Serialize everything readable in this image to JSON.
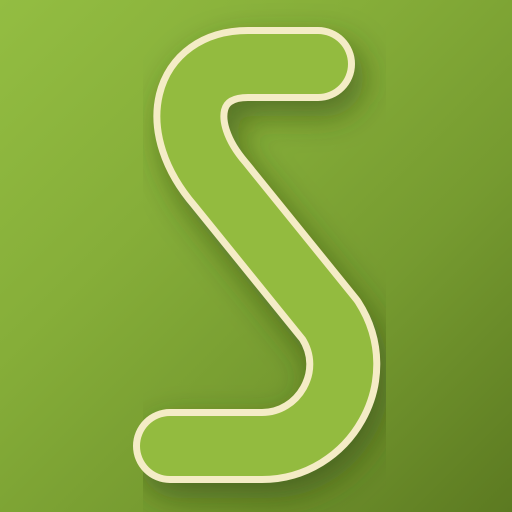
{
  "icon": {
    "name": "s-letter-icon",
    "colors": {
      "background_light": "#93bd42",
      "background_dark": "#5c7a21",
      "glyph_fill": "#93bb3f",
      "glyph_outline": "#f4ecc6",
      "shadow": "#2f4410"
    }
  }
}
